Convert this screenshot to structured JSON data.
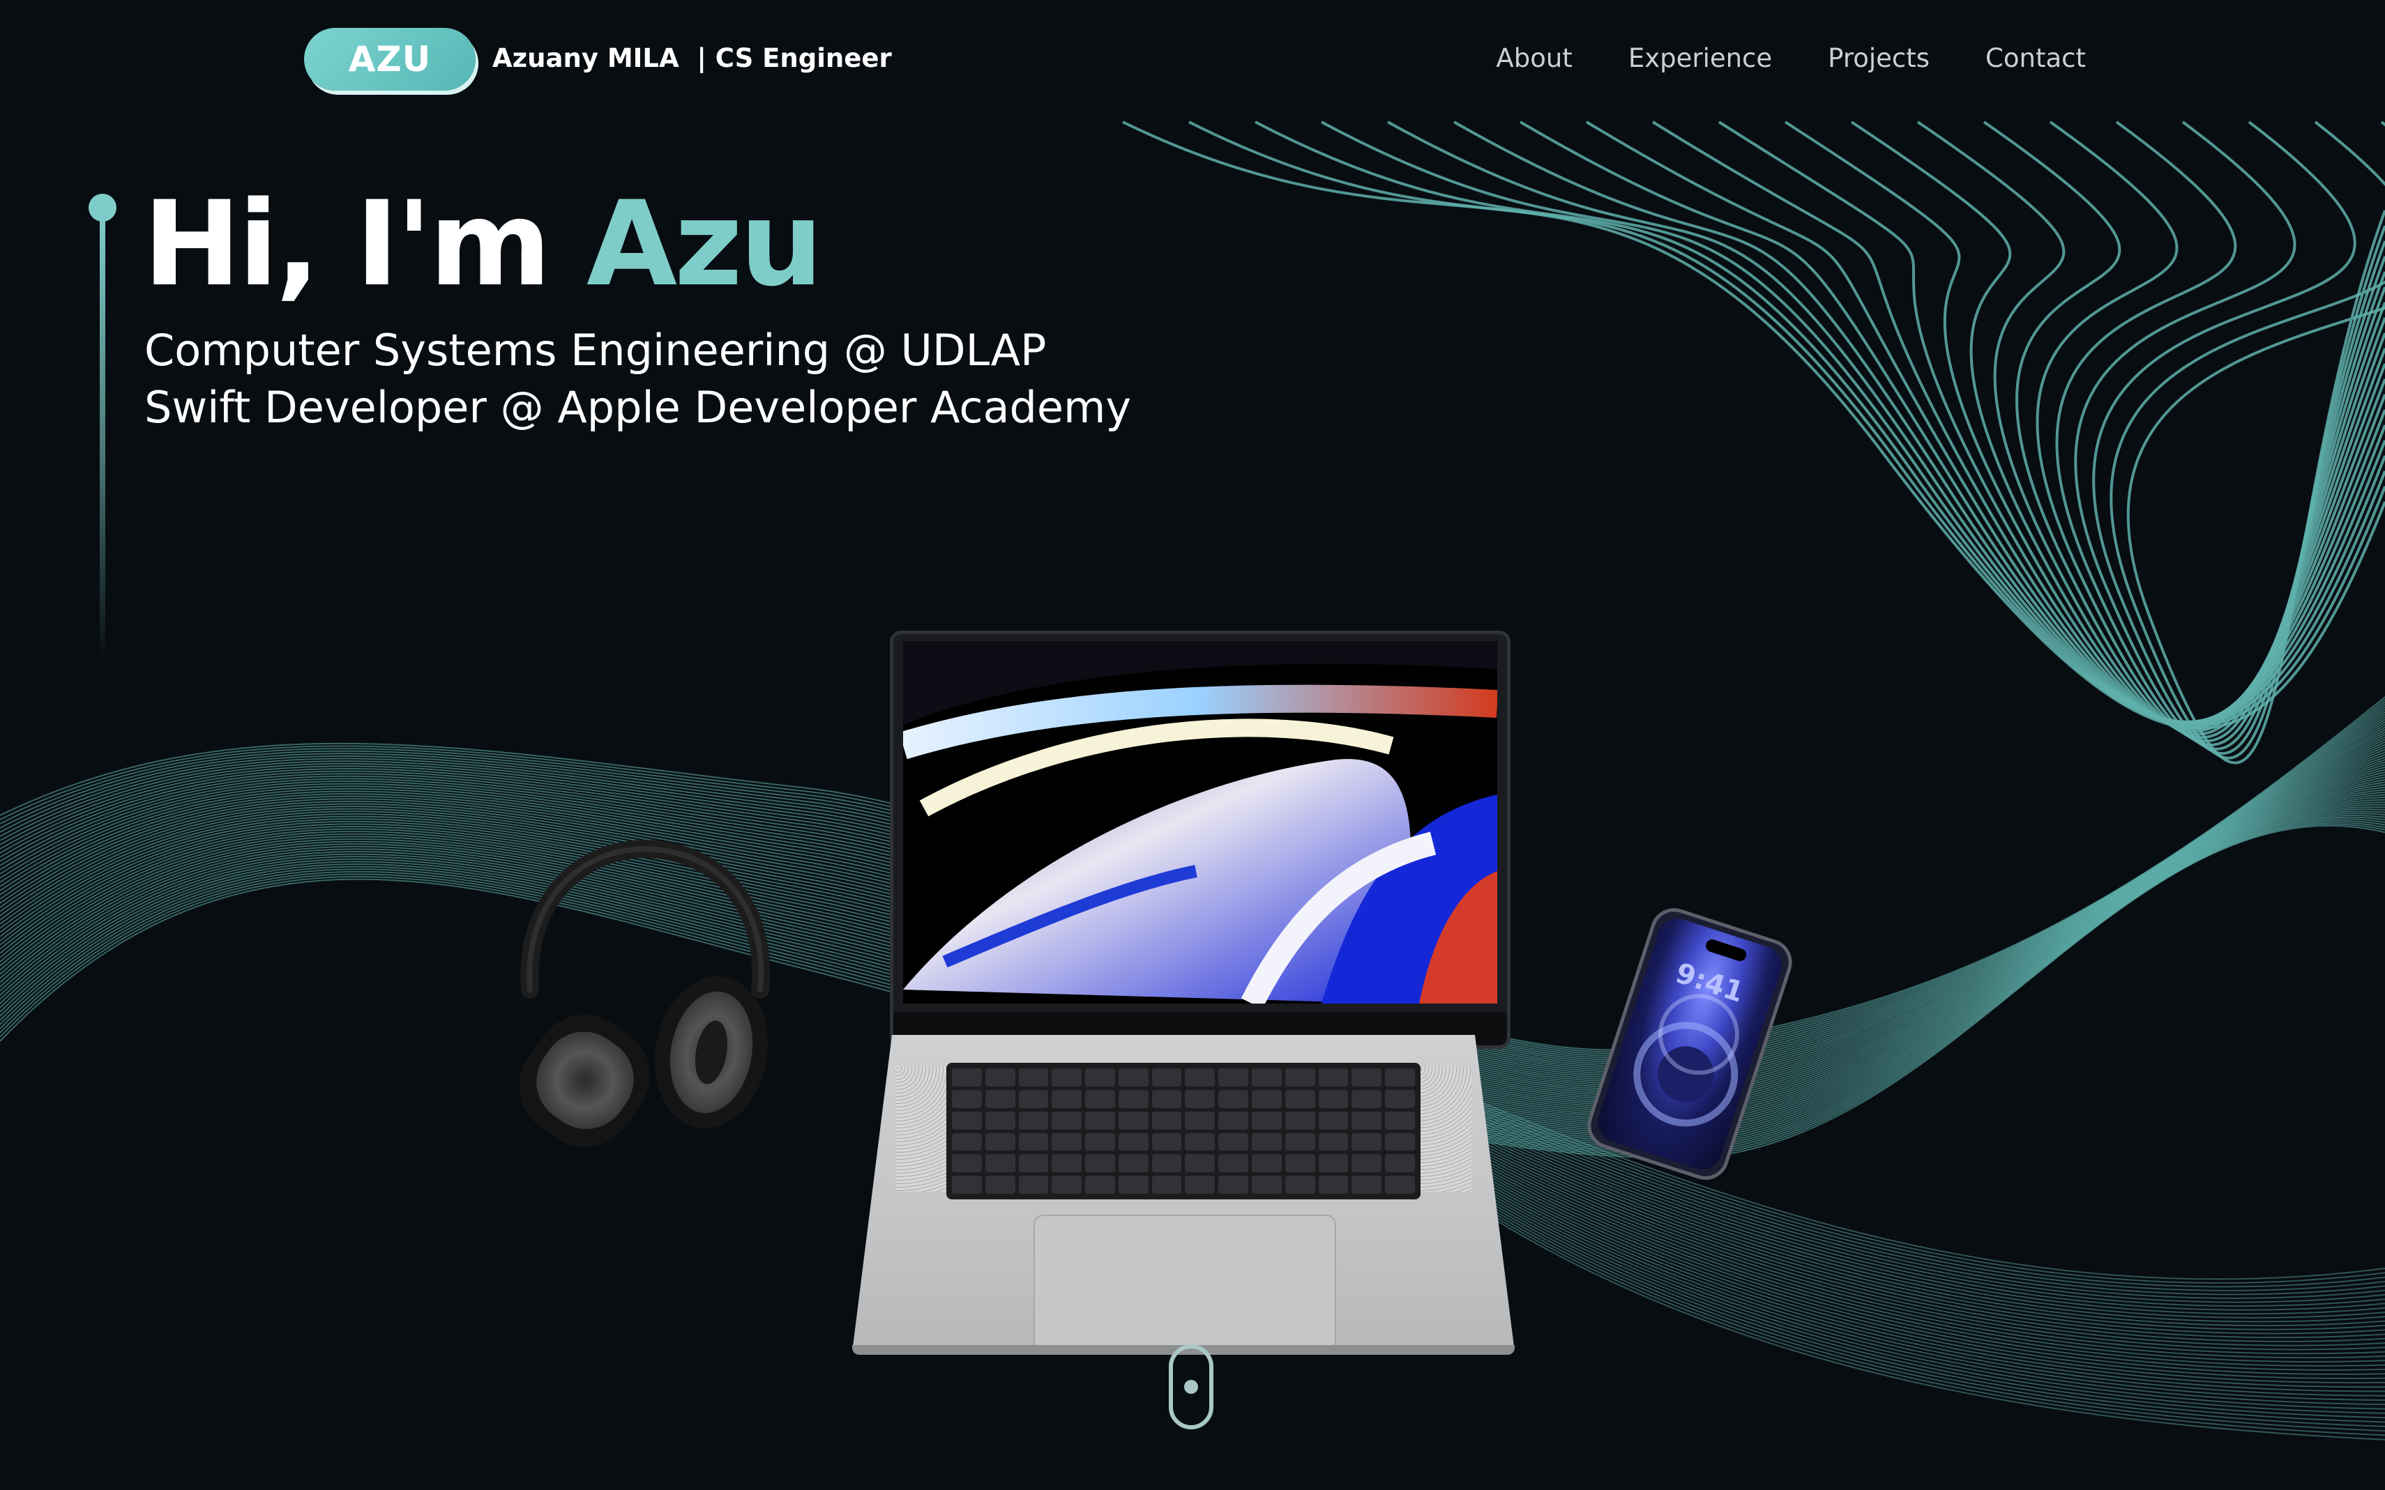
{
  "nav": {
    "logo_text": "AZU",
    "brand_name": "Azuany MILA  | CS Engineer",
    "links": [
      {
        "label": "About"
      },
      {
        "label": "Experience"
      },
      {
        "label": "Projects"
      },
      {
        "label": "Contact"
      }
    ]
  },
  "hero": {
    "greeting": "Hi, I'm",
    "name": "Azu",
    "subtitle_lines": [
      "Computer Systems Engineering @ UDLAP",
      "Swift Developer @ Apple Developer Academy"
    ]
  },
  "devices": {
    "phone_time": "9:41",
    "items": [
      "headphones",
      "laptop",
      "phone"
    ]
  },
  "icons": {
    "scroll": "mouse-scroll-icon"
  },
  "colors": {
    "background": "#080d12",
    "accent": "#7fcdc8",
    "wave_lines": "#5fb0ab",
    "text": "#ffffff",
    "nav_text": "#c9d1d6"
  }
}
